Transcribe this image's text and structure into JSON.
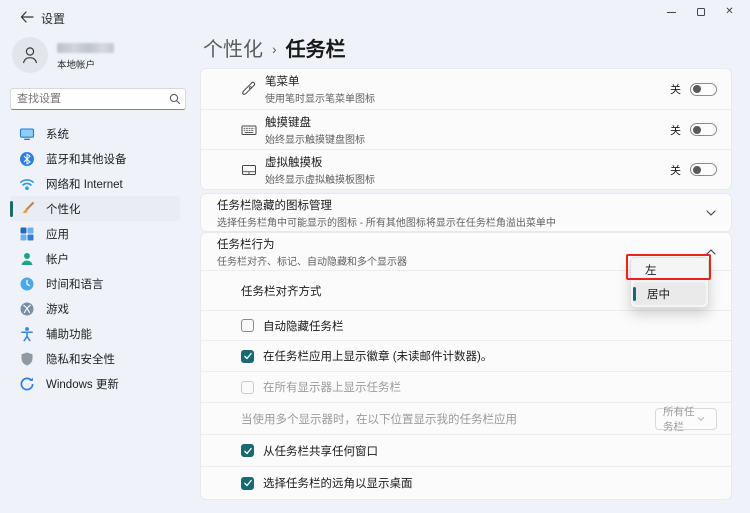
{
  "titlebar": {
    "app_title": "设置"
  },
  "sidebar": {
    "user": {
      "account_type": "本地帐户"
    },
    "search": {
      "placeholder": "查找设置"
    },
    "items": [
      {
        "label": "系统",
        "icon": "system-icon",
        "selected": false
      },
      {
        "label": "蓝牙和其他设备",
        "icon": "bluetooth-icon",
        "selected": false
      },
      {
        "label": "网络和 Internet",
        "icon": "network-icon",
        "selected": false
      },
      {
        "label": "个性化",
        "icon": "personalization-icon",
        "selected": true
      },
      {
        "label": "应用",
        "icon": "apps-icon",
        "selected": false
      },
      {
        "label": "帐户",
        "icon": "accounts-icon",
        "selected": false
      },
      {
        "label": "时间和语言",
        "icon": "time-language-icon",
        "selected": false
      },
      {
        "label": "游戏",
        "icon": "gaming-icon",
        "selected": false
      },
      {
        "label": "辅助功能",
        "icon": "accessibility-icon",
        "selected": false
      },
      {
        "label": "隐私和安全性",
        "icon": "privacy-icon",
        "selected": false
      },
      {
        "label": "Windows 更新",
        "icon": "windows-update-icon",
        "selected": false
      }
    ]
  },
  "breadcrumb": {
    "parent": "个性化",
    "separator": "›",
    "current": "任务栏"
  },
  "content": {
    "corner_icon_rows": [
      {
        "title": "笔菜单",
        "subtitle": "使用笔时显示笔菜单图标",
        "icon": "pen-icon",
        "state_label": "关",
        "on": false
      },
      {
        "title": "触摸键盘",
        "subtitle": "始终显示触摸键盘图标",
        "icon": "touch-keyboard-icon",
        "state_label": "关",
        "on": false
      },
      {
        "title": "虚拟触摸板",
        "subtitle": "始终显示虚拟触摸板图标",
        "icon": "virtual-touchpad-icon",
        "state_label": "关",
        "on": false
      }
    ],
    "overflow_section": {
      "title": "任务栏隐藏的图标管理",
      "subtitle": "选择任务栏角中可能显示的图标 - 所有其他图标将显示在任务栏角溢出菜单中",
      "expanded": false
    },
    "behaviors_section": {
      "title": "任务栏行为",
      "subtitle": "任务栏对齐、标记、自动隐藏和多个显示器",
      "expanded": true,
      "alignment_label": "任务栏对齐方式",
      "alignment_options": {
        "left": "左",
        "center": "居中",
        "selected": "居中"
      },
      "checkboxes": [
        {
          "label": "自动隐藏任务栏",
          "checked": false,
          "disabled": false
        },
        {
          "label": "在任务栏应用上显示徽章 (未读邮件计数器)。",
          "checked": true,
          "disabled": false
        },
        {
          "label": "在所有显示器上显示任务栏",
          "checked": false,
          "disabled": true
        }
      ],
      "multi_display": {
        "label": "当使用多个显示器时，在以下位置显示我的任务栏应用",
        "value": "所有任务栏",
        "disabled": true
      },
      "checkboxes_bottom": [
        {
          "label": "从任务栏共享任何窗口",
          "checked": true
        },
        {
          "label": "选择任务栏的远角以显示桌面",
          "checked": true
        }
      ]
    },
    "annotation": {
      "shape": "red-rectangle",
      "target_option": "左",
      "color": "#e52718"
    }
  },
  "colors": {
    "accent": "#186a70",
    "annotation_red": "#e52718",
    "background": "#eff3f9"
  }
}
